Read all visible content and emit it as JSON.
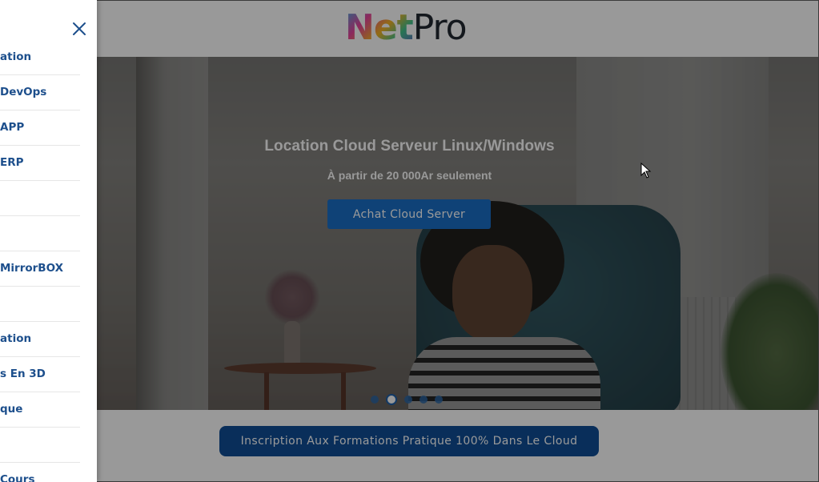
{
  "brand": {
    "logo_part1": "Net",
    "logo_part2": "Pro"
  },
  "hero": {
    "title": "Location Cloud Serveur Linux/Windows",
    "subtitle": "À partir de 20 000Ar seulement",
    "button_label": "Achat Cloud Server",
    "slides_total": 5,
    "active_slide": 2
  },
  "cta": {
    "label": "Inscription Aux Formations Pratique 100% Dans Le Cloud"
  },
  "sidebar": {
    "items": [
      {
        "label": "ation"
      },
      {
        "label": "DevOps"
      },
      {
        "label": " APP"
      },
      {
        "label": "ERP"
      },
      {
        "label": ""
      },
      {
        "label": ""
      },
      {
        "label": "MirrorBOX"
      },
      {
        "label": ""
      },
      {
        "label": "ation"
      },
      {
        "label": "s En 3D"
      },
      {
        "label": "que"
      },
      {
        "label": ""
      },
      {
        "label": "Cours"
      }
    ]
  },
  "colors": {
    "accent": "#1a6ec7",
    "cta": "#0f4d96",
    "menu_text": "#1d4f8c"
  }
}
